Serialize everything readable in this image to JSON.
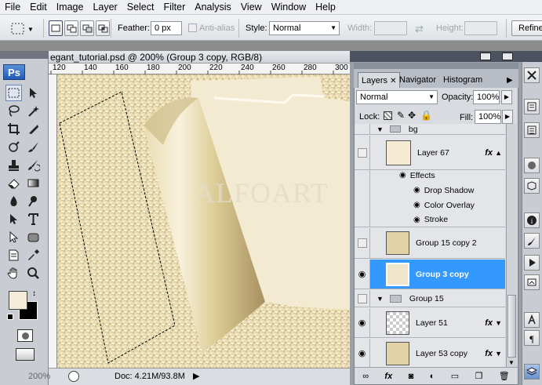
{
  "menu": {
    "items": [
      "File",
      "Edit",
      "Image",
      "Layer",
      "Select",
      "Filter",
      "Analysis",
      "View",
      "Window",
      "Help"
    ]
  },
  "options": {
    "feather_label": "Feather:",
    "feather_value": "0 px",
    "antialias_label": "Anti-alias",
    "style_label": "Style:",
    "style_value": "Normal",
    "width_label": "Width:",
    "height_label": "Height:",
    "refine_label": "Refine"
  },
  "tools": {
    "logo": "Ps"
  },
  "document": {
    "title": "egant_tutorial.psd @ 200% (Group 3 copy, RGB/8)",
    "ruler_ticks": [
      "120",
      "140",
      "160",
      "180",
      "200",
      "220",
      "240",
      "260",
      "280",
      "300"
    ],
    "watermark": "ALFOART",
    "zoom": "200%",
    "doc_info": "Doc: 4.21M/93.8M"
  },
  "layers_panel": {
    "tabs": [
      "Layers",
      "Navigator",
      "Histogram"
    ],
    "blend_mode": "Normal",
    "opacity_label": "Opacity:",
    "opacity_value": "100%",
    "lock_label": "Lock:",
    "fill_label": "Fill:",
    "fill_value": "100%",
    "group_bg": "bg",
    "layer67": "Layer 67",
    "effects_label": "Effects",
    "effects": [
      "Drop Shadow",
      "Color Overlay",
      "Stroke"
    ],
    "group15copy2": "Group 15 copy 2",
    "group3copy": "Group 3 copy",
    "group15": "Group 15",
    "layer51": "Layer 51",
    "layer53copy": "Layer 53 copy",
    "fx": "fx"
  },
  "colors": {
    "selection_blue": "#3399ff",
    "paper": "#f1e8d2",
    "sparkle": "#e0cf9a"
  }
}
